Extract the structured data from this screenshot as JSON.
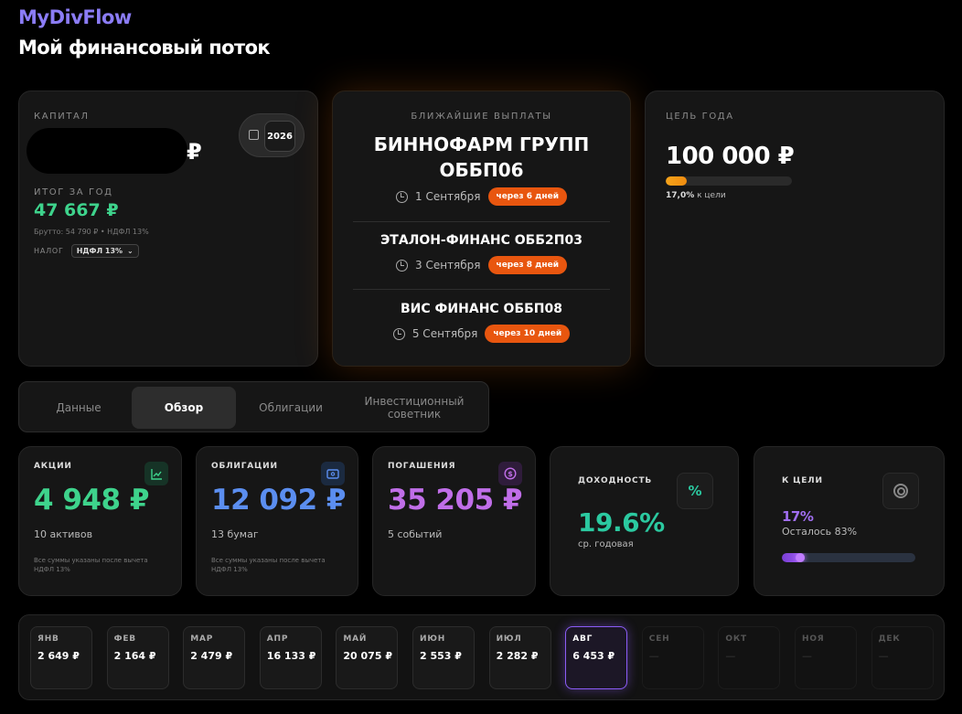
{
  "app": {
    "brand": "MyDivFlow",
    "title": "Мой финансовый поток"
  },
  "capital": {
    "label": "КАПИТАЛ",
    "currency": "₽",
    "year": "2026",
    "year_total_label": "ИТОГ ЗА ГОД",
    "year_total": "47 667 ₽",
    "gross_note": "Брутто: 54 790 ₽ • НДФЛ 13%",
    "tax_label": "НАЛОГ",
    "tax_value": "НДФЛ 13%"
  },
  "payouts": {
    "label": "БЛИЖАЙШИЕ ВЫПЛАТЫ",
    "items": [
      {
        "name_line1": "БИННОФАРМ ГРУПП",
        "name_line2": "ОББП06",
        "date": "1 Сентября",
        "badge": "через 6 дней"
      },
      {
        "name": "ЭТАЛОН-ФИНАНС ОББ2П03",
        "date": "3 Сентября",
        "badge": "через 8 дней"
      },
      {
        "name": "ВИС ФИНАНС ОББП08",
        "date": "5 Сентября",
        "badge": "через 10 дней"
      }
    ]
  },
  "goal": {
    "label": "ЦЕЛЬ ГОДА",
    "value": "100 000 ₽",
    "progress": 0.17,
    "percent_text": "17,0%",
    "percent_suffix": "к цели"
  },
  "tabs": [
    {
      "label": "Данные"
    },
    {
      "label": "Обзор"
    },
    {
      "label": "Облигации"
    },
    {
      "label": "Инвестиционный советник"
    }
  ],
  "stats": {
    "stocks": {
      "label": "АКЦИИ",
      "value": "4 948 ₽",
      "sub": "10 активов",
      "note": "Все суммы указаны после вычета НДФЛ 13%",
      "color": "#3ed38c"
    },
    "bonds": {
      "label": "ОБЛИГАЦИИ",
      "value": "12 092 ₽",
      "sub": "13 бумаг",
      "note": "Все суммы указаны после вычета НДФЛ 13%",
      "color": "#5b8ef0"
    },
    "redemptions": {
      "label": "ПОГАШЕНИЯ",
      "value": "35 205 ₽",
      "sub": "5 событий",
      "color": "#c06ee8"
    },
    "yield": {
      "label": "ДОХОДНОСТЬ",
      "value": "19.6%",
      "sub": "ср. годовая",
      "color": "#2bc9a0"
    },
    "target": {
      "label": "К ЦЕЛИ",
      "value": "17%",
      "sub": "Осталось 83%",
      "progress": 0.17,
      "color": "#a06ef0"
    }
  },
  "months": [
    {
      "m": "ЯНВ",
      "v": "2 649 ₽"
    },
    {
      "m": "ФЕВ",
      "v": "2 164 ₽"
    },
    {
      "m": "МАР",
      "v": "2 479 ₽"
    },
    {
      "m": "АПР",
      "v": "16 133 ₽"
    },
    {
      "m": "МАЙ",
      "v": "20 075 ₽"
    },
    {
      "m": "ИЮН",
      "v": "2 553 ₽"
    },
    {
      "m": "ИЮЛ",
      "v": "2 282 ₽"
    },
    {
      "m": "АВГ",
      "v": "6 453 ₽"
    },
    {
      "m": "СЕН",
      "v": "—"
    },
    {
      "m": "ОКТ",
      "v": "—"
    },
    {
      "m": "НОЯ",
      "v": "—"
    },
    {
      "m": "ДЕК",
      "v": "—"
    }
  ]
}
